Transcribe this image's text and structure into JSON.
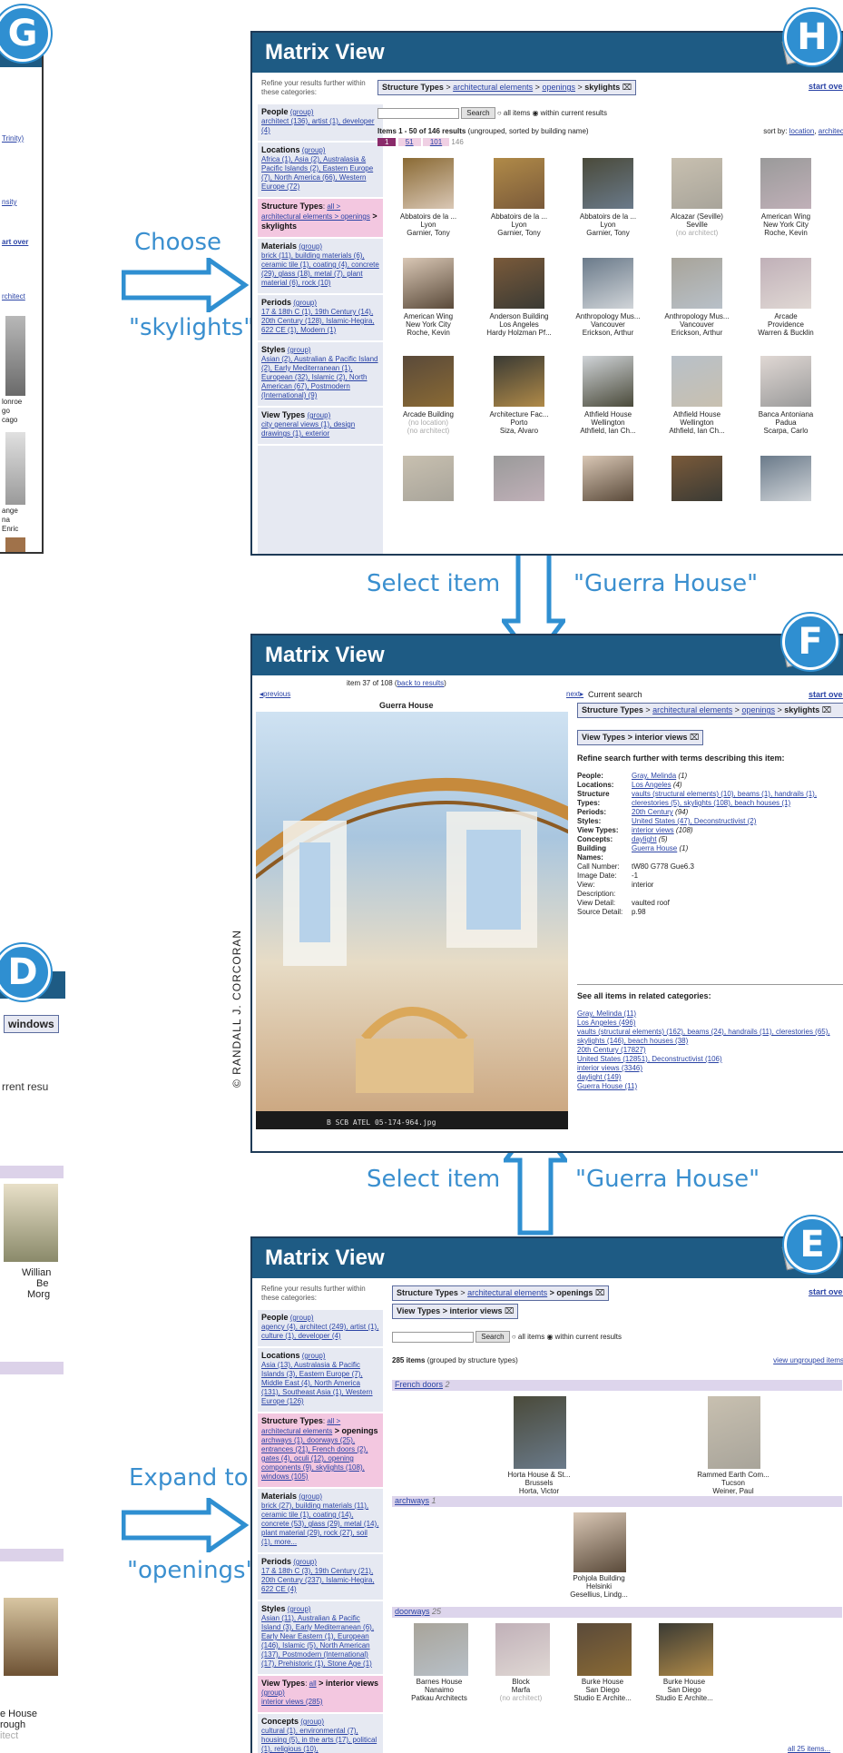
{
  "labels": {
    "G": "G",
    "H": "H",
    "F": "F",
    "D": "D",
    "E": "E"
  },
  "steps": {
    "choose_1": "Choose",
    "choose_2": "\"skylights\"",
    "select_item": "Select item",
    "guerra": "\"Guerra House\"",
    "expand_1": "Expand to",
    "expand_2": "\"openings\""
  },
  "copyright": "© RANDALL J. CORCORAN",
  "screen_g": {
    "lines": [
      "Trinity)",
      "nsity",
      "art over",
      "rchitect",
      "lonroe",
      "go",
      "cago",
      "ange",
      "na",
      "Enric"
    ]
  },
  "screen_d": {
    "windows": "windows",
    "rent": "rrent resu",
    "william": "Willian",
    "be": "Be",
    "morg": "Morg",
    "house": "e House",
    "rough": "rough",
    "itect": "itect"
  },
  "screen_h": {
    "title": "Matrix View",
    "refine": "Refine your results further within these categories:",
    "crumb": {
      "lead": "Structure Types",
      "sep": " > ",
      "l1": "architectural elements",
      "l2": "openings",
      "current": "skylights",
      "close": "⌧"
    },
    "start_over": "start over",
    "search_btn": "Search",
    "all_items": "all items",
    "within": "within current results",
    "items_count": "Items 1 - 50 of 146 results",
    "items_note": " (ungrouped, sorted by building name)",
    "sort_by": "sort by:",
    "sort_loc": "location",
    "sort_arch": "architect",
    "pages": [
      "1",
      "51",
      "101",
      "146"
    ],
    "people": {
      "head": "People",
      "group": "(group)",
      "body": "architect (136), artist (1), developer (4)"
    },
    "locations": {
      "head": "Locations",
      "group": "(group)",
      "body": "Africa (1), Asia (2), Australasia & Pacific Islands (2), Eastern Europe (7), North America (66), Western Europe (72)"
    },
    "structure": {
      "head": "Structure Types",
      "sep": ": ",
      "all": "all",
      "mid": " > architectural elements > openings",
      "current": " > skylights"
    },
    "materials": {
      "head": "Materials",
      "group": "(group)",
      "body": "brick (11), building materials (6), ceramic tile (1), coating (4), concrete (29), glass (18), metal (7), plant material (6), rock (10)"
    },
    "periods": {
      "head": "Periods",
      "group": "(group)",
      "body": "17 & 18th C (1), 19th Century (14), 20th Century (128), Islamic-Hegira, 622 CE (1), Modern (1)"
    },
    "styles": {
      "head": "Styles",
      "group": "(group)",
      "body": "Asian (2), Australian & Pacific Island (2), Early Mediterranean (1), European (32), Islamic (2), North American (67), Postmodern (International) (9)"
    },
    "viewtypes": {
      "head": "View Types",
      "group": "(group)",
      "body": "city general views (1), design drawings (1), exterior"
    },
    "items": [
      {
        "t1": "Abbatoirs de la ...",
        "t2": "Lyon",
        "t3": "Garnier, Tony"
      },
      {
        "t1": "Abbatoirs de la ...",
        "t2": "Lyon",
        "t3": "Garnier, Tony"
      },
      {
        "t1": "Abbatoirs de la ...",
        "t2": "Lyon",
        "t3": "Garnier, Tony"
      },
      {
        "t1": "Alcazar (Seville)",
        "t2": "Seville",
        "t3": "(no architect)"
      },
      {
        "t1": "American Wing",
        "t2": "New York City",
        "t3": "Roche, Kevin"
      },
      {
        "t1": "American Wing",
        "t2": "New York City",
        "t3": "Roche, Kevin"
      },
      {
        "t1": "Anderson Building",
        "t2": "Los Angeles",
        "t3": "Hardy Holzman Pf..."
      },
      {
        "t1": "Anthropology Mus...",
        "t2": "Vancouver",
        "t3": "Erickson, Arthur"
      },
      {
        "t1": "Anthropology Mus...",
        "t2": "Vancouver",
        "t3": "Erickson, Arthur"
      },
      {
        "t1": "Arcade",
        "t2": "Providence",
        "t3": "Warren & Bucklin"
      },
      {
        "t1": "Arcade Building",
        "t2": "(no location)",
        "t3": "(no architect)"
      },
      {
        "t1": "Architecture Fac...",
        "t2": "Porto",
        "t3": "Siza, Alvaro"
      },
      {
        "t1": "Athfield House",
        "t2": "Wellington",
        "t3": "Athfield, Ian Ch..."
      },
      {
        "t1": "Athfield House",
        "t2": "Wellington",
        "t3": "Athfield, Ian Ch..."
      },
      {
        "t1": "Banca Antoniana",
        "t2": "Padua",
        "t3": "Scarpa, Carlo"
      }
    ]
  },
  "screen_f": {
    "title": "Matrix View",
    "previous": "previous",
    "item_of": "item 37 of 108 (",
    "back": "back to results",
    "close_paren": ")",
    "next": "next",
    "current_search": "Current search",
    "start_over": "start over",
    "image_title": "Guerra House",
    "image_caption": "B  SCB ATEL  05-174-964.jpg",
    "crumb1": {
      "lead": "Structure Types",
      "sep1": " > ",
      "l1": "architectural elements",
      "sep2": " > ",
      "l2": "openings",
      "sep3": " > ",
      "current": "skylights",
      "close": "⌧"
    },
    "crumb2": {
      "lead": "View Types",
      "current": " > interior views",
      "close": "⌧"
    },
    "refine": "Refine search further with terms describing this item:",
    "meta": [
      {
        "k": "People:",
        "v": "Gray, Melinda",
        "n": " (1)"
      },
      {
        "k": "Locations:",
        "v": "Los Angeles",
        "n": " (4)"
      },
      {
        "k": "Structure Types:",
        "v": "vaults (structural elements) (10), beams (1), handrails (1), clerestories (5), skylights (108), beach houses (1)",
        "n": ""
      },
      {
        "k": "Periods:",
        "v": "20th Century",
        "n": " (94)"
      },
      {
        "k": "Styles:",
        "v": "United States (47), Deconstructivist (2)",
        "n": ""
      },
      {
        "k": "View Types:",
        "v": "interior views",
        "n": " (108)"
      },
      {
        "k": "Concepts:",
        "v": "daylight",
        "n": " (5)"
      },
      {
        "k": "Building Names:",
        "v": "Guerra House",
        "n": " (1)"
      }
    ],
    "plain": [
      {
        "k": "Call Number:",
        "v": "tW80 G778 Gue6.3"
      },
      {
        "k": "Image Date:",
        "v": "-1"
      },
      {
        "k": "View:",
        "v": "interior"
      },
      {
        "k": "Description:",
        "v": ""
      },
      {
        "k": "View Detail:",
        "v": "vaulted roof"
      },
      {
        "k": "Source Detail:",
        "v": "p.98"
      }
    ],
    "see_all": "See all items in related categories:",
    "related": [
      "Gray, Melinda (11)",
      "Los Angeles (496)",
      "vaults (structural elements) (162), beams (24), handrails (11), clerestories (65), skylights (146), beach houses (38)",
      "20th Century (17827)",
      "United States (12851), Deconstructivist (106)",
      "interior views (3346)",
      "daylight (149)",
      "Guerra House (11)"
    ]
  },
  "screen_e": {
    "title": "Matrix View",
    "refine": "Refine your results further within these categories:",
    "crumb1": {
      "lead": "Structure Types",
      "sep": " > ",
      "l1": "architectural elements",
      "current": " > openings",
      "close": "⌧"
    },
    "crumb2": {
      "lead": "View Types",
      "current": " > interior views",
      "close": "⌧"
    },
    "start_over": "start over",
    "search_btn": "Search",
    "all_items": "all items",
    "within": "within current results",
    "count": "285 items",
    "count_note": " (grouped by structure types)",
    "view_ungrouped": "view ungrouped items",
    "people": {
      "head": "People",
      "group": "(group)",
      "body": "agency (4), architect (249), artist (1), culture (1), developer (4)"
    },
    "locations": {
      "head": "Locations",
      "group": "(group)",
      "body": "Asia (13), Australasia & Pacific Islands (3), Eastern Europe (7), Middle East (4), North America (131), Southeast Asia (1), Western Europe (126)"
    },
    "structure": {
      "head": "Structure Types",
      "sep": ": ",
      "all": "all",
      "mid": " > architectural elements",
      "current": " > openings",
      "body": "archways (1), doorways (25), entrances (21), French doors (2), gates (4), oculi (12), opening components (9), skylights (108), windows (105)"
    },
    "materials": {
      "head": "Materials",
      "group": "(group)",
      "body": "brick (27), building materials (11), ceramic tile (1), coating (14), concrete (53), glass (29), metal (14), plant material (29), rock (27), soil (1), more..."
    },
    "periods": {
      "head": "Periods",
      "group": "(group)",
      "body": "17 & 18th C (3), 19th Century (21), 20th Century (237), Islamic-Hegira, 622 CE (4)"
    },
    "styles": {
      "head": "Styles",
      "group": "(group)",
      "body": "Asian (11), Australian & Pacific Island (3), Early Mediterranean (6), Early Near Eastern (1), European (146), Islamic (5), North American (137), Postmodern (International) (17), Prehistoric (1), Stone Age (1)"
    },
    "viewtypes": {
      "head": "View Types",
      "sep": ": ",
      "all": "all",
      "current": " > interior views",
      "group": "(group)",
      "body": "interior views (285)"
    },
    "concepts": {
      "head": "Concepts",
      "group": "(group)",
      "body": "cultural (1), environmental (7), housing (5), in the arts (17), political (1), religious (10),"
    },
    "groups": [
      {
        "name": "French doors",
        "count": "2",
        "items": [
          {
            "t1": "Horta House & St...",
            "t2": "Brussels",
            "t3": "Horta, Victor"
          },
          {
            "t1": "Rammed Earth Com...",
            "t2": "Tucson",
            "t3": "Weiner, Paul"
          }
        ]
      },
      {
        "name": "archways",
        "count": "1",
        "items": [
          {
            "t1": "Pohjola Building",
            "t2": "Helsinki",
            "t3": "Gesellius, Lindg..."
          }
        ]
      },
      {
        "name": "doorways",
        "count": "25",
        "items": [
          {
            "t1": "Barnes House",
            "t2": "Nanaimo",
            "t3": "Patkau Architects"
          },
          {
            "t1": "Block",
            "t2": "Marfa",
            "t3": "(no architect)"
          },
          {
            "t1": "Burke House",
            "t2": "San Diego",
            "t3": "Studio E Archite..."
          },
          {
            "t1": "Burke House",
            "t2": "San Diego",
            "t3": "Studio E Archite..."
          }
        ]
      }
    ],
    "all_items_link": "all 25 items..."
  }
}
